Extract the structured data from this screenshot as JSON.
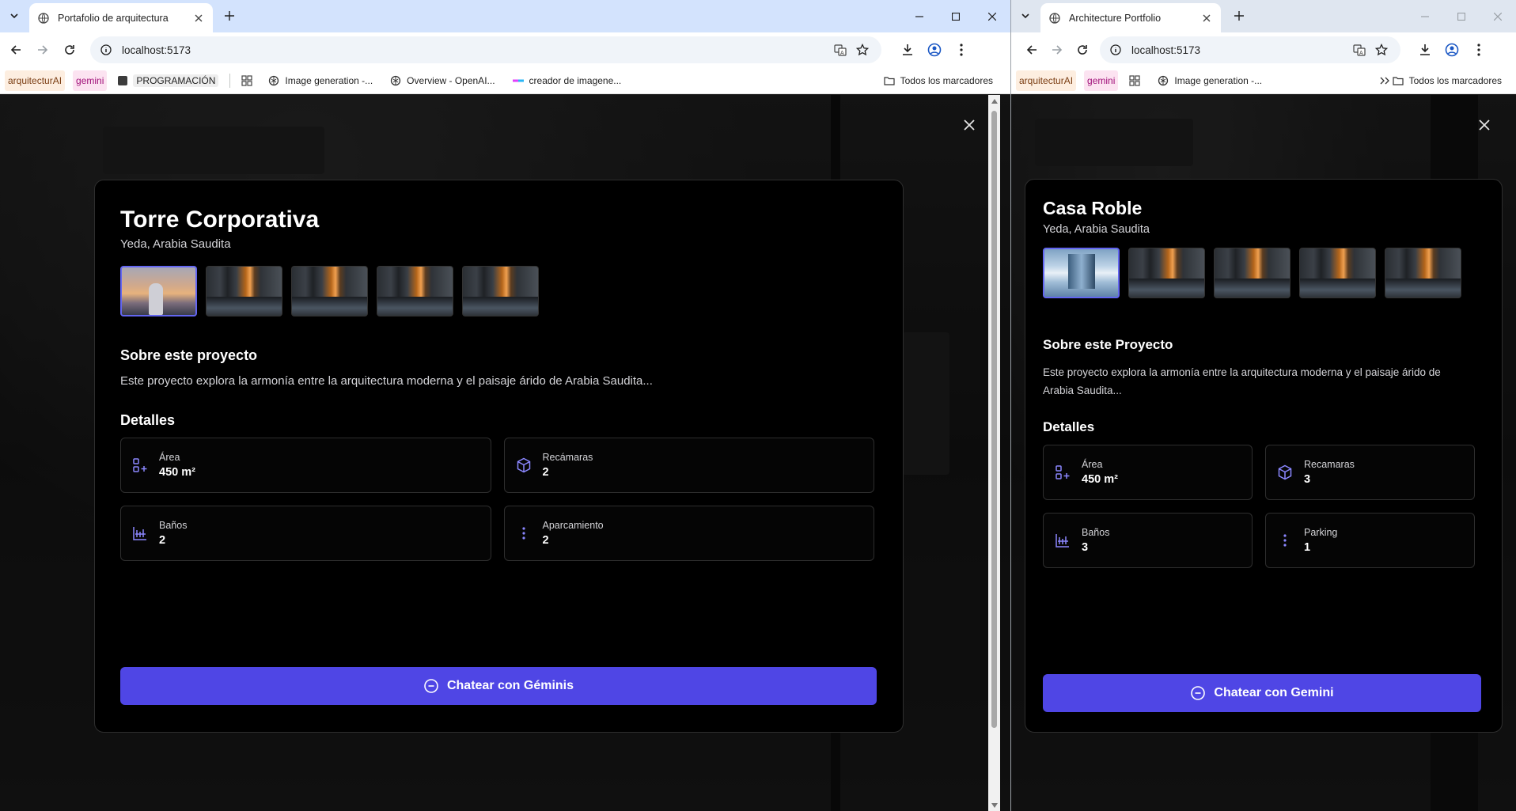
{
  "left": {
    "tab_title": "Portafolio de arquitectura",
    "url": "localhost:5173",
    "bookmarks": [
      {
        "label": "arquitecturAI"
      },
      {
        "label": "gemini"
      },
      {
        "label": "PROGRAMACIÓN"
      },
      {
        "label": "Image generation -..."
      },
      {
        "label": "Overview - OpenAI..."
      },
      {
        "label": "creador de imagene..."
      }
    ],
    "all_bookmarks": "Todos los marcadores",
    "project": {
      "title": "Torre Corporativa",
      "location": "Yeda, Arabia Saudita",
      "about_title": "Sobre este proyecto",
      "description": "Este proyecto explora la armonía entre la arquitectura moderna y el paisaje árido de Arabia Saudita...",
      "details_title": "Detalles",
      "details": [
        {
          "label": "Área",
          "value": "450 m²",
          "icon": "area-icon"
        },
        {
          "label": "Recámaras",
          "value": "2",
          "icon": "cube-icon"
        },
        {
          "label": "Baños",
          "value": "2",
          "icon": "bath-icon"
        },
        {
          "label": "Aparcamiento",
          "value": "2",
          "icon": "more-vertical-icon"
        }
      ],
      "cta": "Chatear con Géminis"
    }
  },
  "right": {
    "tab_title": "Architecture Portfolio",
    "url": "localhost:5173",
    "bookmarks": [
      {
        "label": "arquitecturAI"
      },
      {
        "label": "gemini"
      },
      {
        "label": "Image generation -..."
      }
    ],
    "all_bookmarks": "Todos los marcadores",
    "project": {
      "title": "Casa Roble",
      "location": "Yeda, Arabia Saudita",
      "about_title": "Sobre este Proyecto",
      "description": "Este proyecto explora la armonía entre la arquitectura moderna y el paisaje árido de Arabia Saudita...",
      "details_title": "Detalles",
      "details": [
        {
          "label": "Área",
          "value": "450 m²",
          "icon": "area-icon"
        },
        {
          "label": "Recamaras",
          "value": "3",
          "icon": "cube-icon"
        },
        {
          "label": "Baños",
          "value": "3",
          "icon": "bath-icon"
        },
        {
          "label": "Parking",
          "value": "1",
          "icon": "more-vertical-icon"
        }
      ],
      "cta": "Chatear con Gemini"
    }
  },
  "colors": {
    "accent": "#4f46e5",
    "modal_bg": "#000000",
    "tab_strip": "#d3e3fd"
  }
}
